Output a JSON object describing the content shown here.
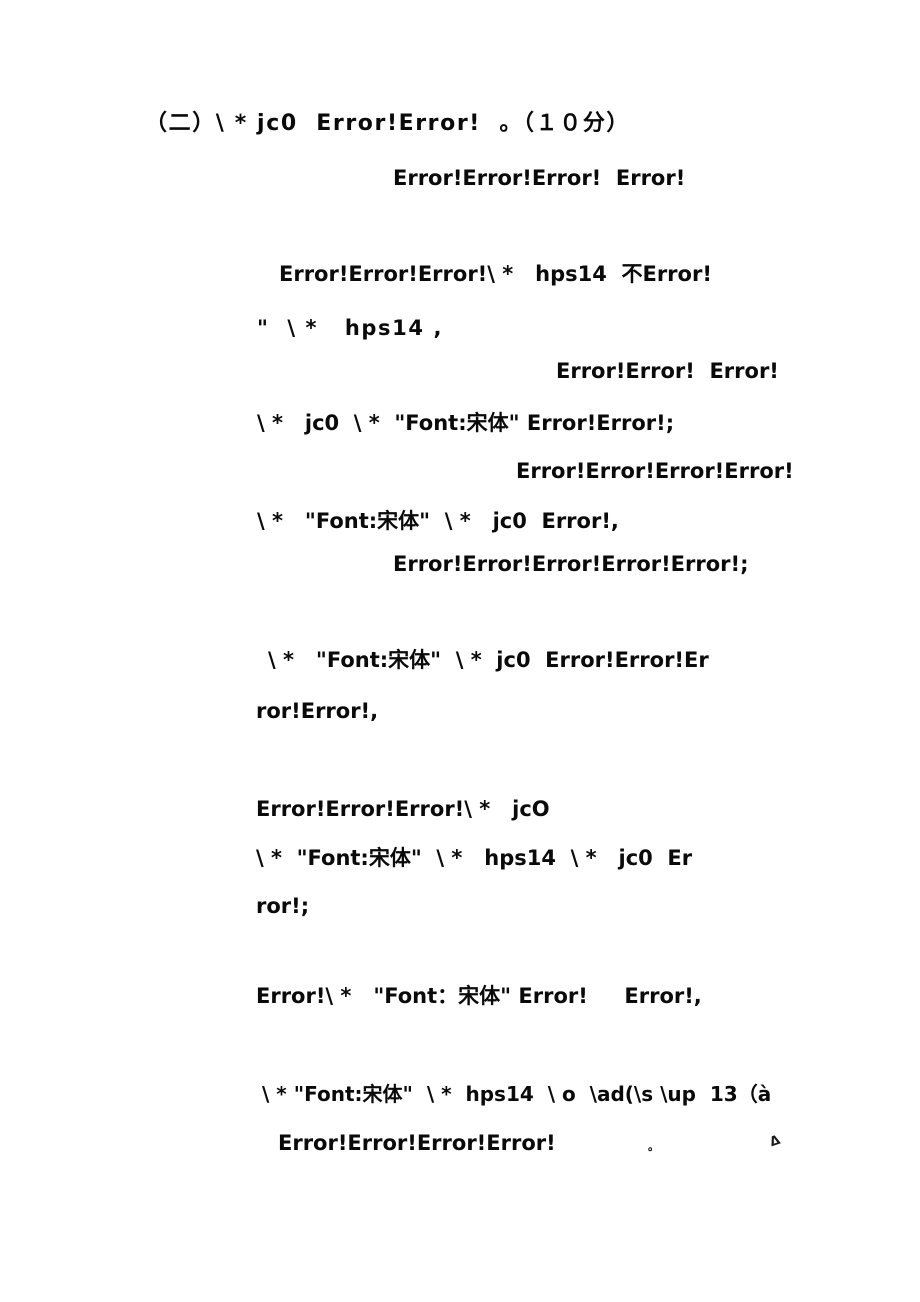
{
  "document": {
    "page_background": "#ffffff",
    "text_color": "#0a0a0a",
    "lines": [
      {
        "id": "l01",
        "text": "（二）\\ * jc0  Error!Error!  。（１０分）"
      },
      {
        "id": "l02",
        "text": "Error!Error!Error!  Error!"
      },
      {
        "id": "l03",
        "text": "Error!Error!Error!\\ *   hps14  不Error!"
      },
      {
        "id": "l04",
        "text": "\"  \\ *   hps14 ,"
      },
      {
        "id": "l05",
        "text": "Error!Error!  Error!"
      },
      {
        "id": "l06",
        "text": "\\ *   jc0  \\ *  \"Font:宋体\" Error!Error!;"
      },
      {
        "id": "l07",
        "text": "Error!Error!Error!Error!"
      },
      {
        "id": "l08",
        "text": "\\ *   \"Font:宋体\"  \\ *   jc0  Error!,"
      },
      {
        "id": "l09",
        "text": "Error!Error!Error!Error!Error!;"
      },
      {
        "id": "l10",
        "text": "\\ *   \"Font:宋体\"  \\ *  jc0  Error!Error!Er"
      },
      {
        "id": "l11",
        "text": "ror!Error!,"
      },
      {
        "id": "l12",
        "text": "Error!Error!Error!\\ *   jcO"
      },
      {
        "id": "l13",
        "text": "\\ *  \"Font:宋体\"  \\ *   hps14  \\ *   jc0  Er"
      },
      {
        "id": "l14",
        "text": "ror!;"
      },
      {
        "id": "l15",
        "text": "Error!\\ *   \"Font：宋体\" Error!     Error!,"
      },
      {
        "id": "l16",
        "text": "\\ * \"Font:宋体\"  \\ *  hps14  \\ o  \\ad(\\s \\up  13（à"
      },
      {
        "id": "l17",
        "text": "Error!Error!Error!Error!"
      },
      {
        "id": "l18",
        "text": "。"
      },
      {
        "id": "l19",
        "text": "ᐃ"
      }
    ]
  }
}
